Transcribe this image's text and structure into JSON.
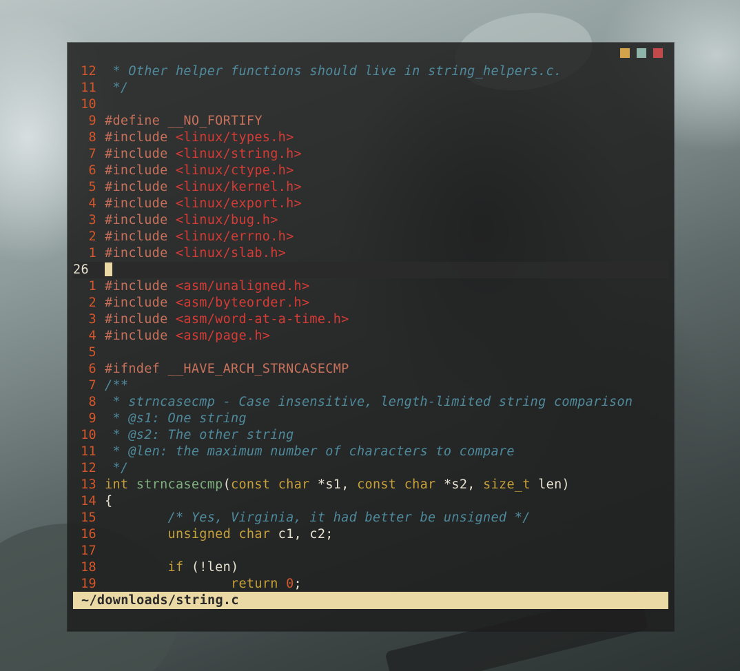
{
  "colors": {
    "line_number": "#d4562a",
    "current_line_number": "#e8e2d0",
    "text": "#e8e2d0",
    "comment": "#4f8a9c",
    "preproc": "#c7705a",
    "include_path": "#d63b35",
    "keyword": "#c7a13a",
    "function": "#7fb07f",
    "number": "#d4562a",
    "statusbar_bg": "#ead9a4",
    "window_btn_yellow": "#d2a34a",
    "window_btn_teal": "#8fb5aa",
    "window_btn_red": "#c24a4a"
  },
  "window": {
    "buttons": [
      {
        "name": "minimize-button",
        "icon": "square-yellow"
      },
      {
        "name": "maximize-button",
        "icon": "square-teal"
      },
      {
        "name": "close-button",
        "icon": "square-red"
      }
    ]
  },
  "editor": {
    "lines": [
      {
        "num": "12",
        "tokens": [
          {
            "t": " * Other helper functions should live in string_helpers.c.",
            "c": "comment",
            "i": true
          }
        ]
      },
      {
        "num": "11",
        "tokens": [
          {
            "t": " */",
            "c": "comment",
            "i": true
          }
        ]
      },
      {
        "num": "10",
        "tokens": []
      },
      {
        "num": "9",
        "tokens": [
          {
            "t": "#define __NO_FORTIFY",
            "c": "preproc"
          }
        ]
      },
      {
        "num": "8",
        "tokens": [
          {
            "t": "#include ",
            "c": "preproc"
          },
          {
            "t": "<linux/types.h>",
            "c": "include_path"
          }
        ]
      },
      {
        "num": "7",
        "tokens": [
          {
            "t": "#include ",
            "c": "preproc"
          },
          {
            "t": "<linux/string.h>",
            "c": "include_path"
          }
        ]
      },
      {
        "num": "6",
        "tokens": [
          {
            "t": "#include ",
            "c": "preproc"
          },
          {
            "t": "<linux/ctype.h>",
            "c": "include_path"
          }
        ]
      },
      {
        "num": "5",
        "tokens": [
          {
            "t": "#include ",
            "c": "preproc"
          },
          {
            "t": "<linux/kernel.h>",
            "c": "include_path"
          }
        ]
      },
      {
        "num": "4",
        "tokens": [
          {
            "t": "#include ",
            "c": "preproc"
          },
          {
            "t": "<linux/export.h>",
            "c": "include_path"
          }
        ]
      },
      {
        "num": "3",
        "tokens": [
          {
            "t": "#include ",
            "c": "preproc"
          },
          {
            "t": "<linux/bug.h>",
            "c": "include_path"
          }
        ]
      },
      {
        "num": "2",
        "tokens": [
          {
            "t": "#include ",
            "c": "preproc"
          },
          {
            "t": "<linux/errno.h>",
            "c": "include_path"
          }
        ]
      },
      {
        "num": "1",
        "tokens": [
          {
            "t": "#include ",
            "c": "preproc"
          },
          {
            "t": "<linux/slab.h>",
            "c": "include_path"
          }
        ]
      },
      {
        "num": "26",
        "current": true,
        "tokens": []
      },
      {
        "num": "1",
        "tokens": [
          {
            "t": "#include ",
            "c": "preproc"
          },
          {
            "t": "<asm/unaligned.h>",
            "c": "include_path"
          }
        ]
      },
      {
        "num": "2",
        "tokens": [
          {
            "t": "#include ",
            "c": "preproc"
          },
          {
            "t": "<asm/byteorder.h>",
            "c": "include_path"
          }
        ]
      },
      {
        "num": "3",
        "tokens": [
          {
            "t": "#include ",
            "c": "preproc"
          },
          {
            "t": "<asm/word-at-a-time.h>",
            "c": "include_path"
          }
        ]
      },
      {
        "num": "4",
        "tokens": [
          {
            "t": "#include ",
            "c": "preproc"
          },
          {
            "t": "<asm/page.h>",
            "c": "include_path"
          }
        ]
      },
      {
        "num": "5",
        "tokens": []
      },
      {
        "num": "6",
        "tokens": [
          {
            "t": "#ifndef __HAVE_ARCH_STRNCASECMP",
            "c": "preproc"
          }
        ]
      },
      {
        "num": "7",
        "tokens": [
          {
            "t": "/**",
            "c": "comment",
            "i": true
          }
        ]
      },
      {
        "num": "8",
        "tokens": [
          {
            "t": " * strncasecmp - Case insensitive, length-limited string comparison",
            "c": "comment",
            "i": true
          }
        ]
      },
      {
        "num": "9",
        "tokens": [
          {
            "t": " * @s1: One string",
            "c": "comment",
            "i": true
          }
        ]
      },
      {
        "num": "10",
        "tokens": [
          {
            "t": " * @s2: The other string",
            "c": "comment",
            "i": true
          }
        ]
      },
      {
        "num": "11",
        "tokens": [
          {
            "t": " * @len: the maximum number of characters to compare",
            "c": "comment",
            "i": true
          }
        ]
      },
      {
        "num": "12",
        "tokens": [
          {
            "t": " */",
            "c": "comment",
            "i": true
          }
        ]
      },
      {
        "num": "13",
        "tokens": [
          {
            "t": "int ",
            "c": "keyword"
          },
          {
            "t": "strncasecmp",
            "c": "function"
          },
          {
            "t": "(",
            "c": "text"
          },
          {
            "t": "const ",
            "c": "keyword"
          },
          {
            "t": "char ",
            "c": "keyword"
          },
          {
            "t": "*s1, ",
            "c": "text"
          },
          {
            "t": "const ",
            "c": "keyword"
          },
          {
            "t": "char ",
            "c": "keyword"
          },
          {
            "t": "*s2, ",
            "c": "text"
          },
          {
            "t": "size_t ",
            "c": "keyword"
          },
          {
            "t": "len)",
            "c": "text"
          }
        ]
      },
      {
        "num": "14",
        "tokens": [
          {
            "t": "{",
            "c": "text"
          }
        ]
      },
      {
        "num": "15",
        "tokens": [
          {
            "t": "        ",
            "c": "text"
          },
          {
            "t": "/* Yes, Virginia, it had better be unsigned */",
            "c": "comment",
            "i": true
          }
        ]
      },
      {
        "num": "16",
        "tokens": [
          {
            "t": "        ",
            "c": "text"
          },
          {
            "t": "unsigned ",
            "c": "keyword"
          },
          {
            "t": "char ",
            "c": "keyword"
          },
          {
            "t": "c1, c2;",
            "c": "text"
          }
        ]
      },
      {
        "num": "17",
        "tokens": []
      },
      {
        "num": "18",
        "tokens": [
          {
            "t": "        ",
            "c": "text"
          },
          {
            "t": "if ",
            "c": "keyword"
          },
          {
            "t": "(!len)",
            "c": "text"
          }
        ]
      },
      {
        "num": "19",
        "tokens": [
          {
            "t": "                ",
            "c": "text"
          },
          {
            "t": "return ",
            "c": "keyword"
          },
          {
            "t": "0",
            "c": "number"
          },
          {
            "t": ";",
            "c": "text"
          }
        ]
      }
    ]
  },
  "statusbar": {
    "file_path": "~/downloads/string.c"
  }
}
